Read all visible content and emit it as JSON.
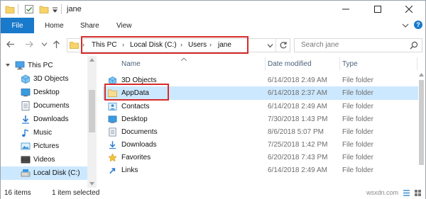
{
  "window": {
    "title": "jane"
  },
  "ribbon": {
    "file": "File",
    "tabs": [
      "Home",
      "Share",
      "View"
    ]
  },
  "address": {
    "crumbs": [
      "This PC",
      "Local Disk (C:)",
      "Users",
      "jane"
    ]
  },
  "search": {
    "placeholder": "Search jane"
  },
  "nav": {
    "items": [
      {
        "label": "This PC",
        "icon": "pc-icon"
      },
      {
        "label": "3D Objects",
        "icon": "3d-objects-icon"
      },
      {
        "label": "Desktop",
        "icon": "desktop-icon"
      },
      {
        "label": "Documents",
        "icon": "documents-icon"
      },
      {
        "label": "Downloads",
        "icon": "downloads-icon"
      },
      {
        "label": "Music",
        "icon": "music-icon"
      },
      {
        "label": "Pictures",
        "icon": "pictures-icon"
      },
      {
        "label": "Videos",
        "icon": "videos-icon"
      },
      {
        "label": "Local Disk (C:)",
        "icon": "drive-icon"
      }
    ]
  },
  "columns": {
    "name": "Name",
    "date": "Date modified",
    "type": "Type"
  },
  "files": [
    {
      "name": "3D Objects",
      "date": "6/14/2018 2:49 AM",
      "type": "File folder",
      "icon": "3d-objects-icon"
    },
    {
      "name": "AppData",
      "date": "6/14/2018 2:37 AM",
      "type": "File folder",
      "icon": "folder-icon"
    },
    {
      "name": "Contacts",
      "date": "6/14/2018 2:49 AM",
      "type": "File folder",
      "icon": "contacts-icon"
    },
    {
      "name": "Desktop",
      "date": "7/30/2018 1:43 PM",
      "type": "File folder",
      "icon": "desktop-icon"
    },
    {
      "name": "Documents",
      "date": "8/6/2018 5:07 PM",
      "type": "File folder",
      "icon": "documents-icon"
    },
    {
      "name": "Downloads",
      "date": "7/25/2018 1:42 PM",
      "type": "File folder",
      "icon": "downloads-icon"
    },
    {
      "name": "Favorites",
      "date": "6/20/2018 7:43 PM",
      "type": "File folder",
      "icon": "favorites-icon"
    },
    {
      "name": "Links",
      "date": "6/14/2018 2:49 AM",
      "type": "File folder",
      "icon": "links-icon"
    }
  ],
  "status": {
    "count": "16 items",
    "selected": "1 item selected"
  },
  "watermark": "wsxdn.com",
  "colors": {
    "accent": "#1979ca",
    "selection": "#cce8ff",
    "highlight": "#d72b2b",
    "folder": "#f6d36b"
  }
}
